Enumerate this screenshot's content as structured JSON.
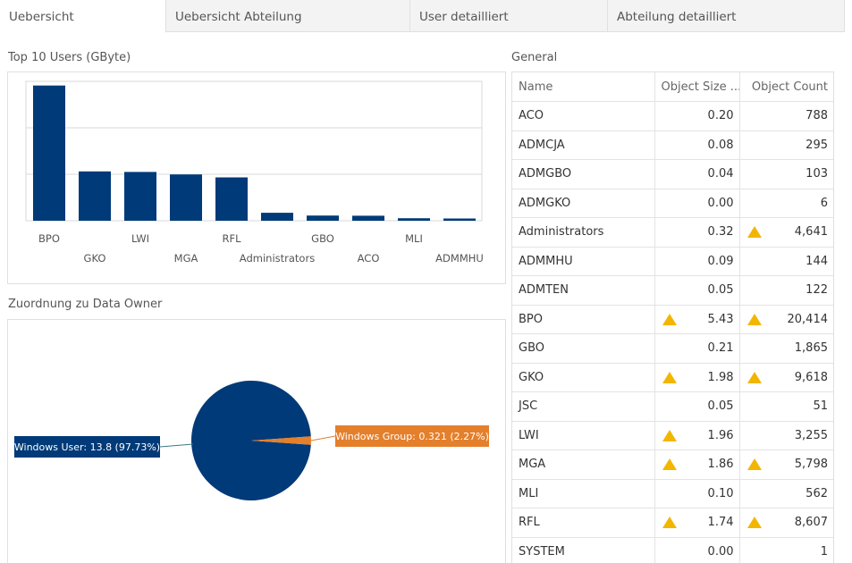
{
  "tabs": [
    "Uebersicht",
    "Uebersicht Abteilung",
    "User detailliert",
    "Abteilung detailliert"
  ],
  "top_users": {
    "title": "Top 10 Users (GByte)"
  },
  "owner": {
    "title": "Zuordnung zu Data Owner"
  },
  "general": {
    "title": "General",
    "columns": [
      "Name",
      "Object Size ...",
      "Object Count"
    ],
    "rows": [
      {
        "name": "ACO",
        "size": "0.20",
        "count": "788",
        "size_warn": false,
        "count_warn": false
      },
      {
        "name": "ADMCJA",
        "size": "0.08",
        "count": "295",
        "size_warn": false,
        "count_warn": false
      },
      {
        "name": "ADMGBO",
        "size": "0.04",
        "count": "103",
        "size_warn": false,
        "count_warn": false
      },
      {
        "name": "ADMGKO",
        "size": "0.00",
        "count": "6",
        "size_warn": false,
        "count_warn": false
      },
      {
        "name": "Administrators",
        "size": "0.32",
        "count": "4,641",
        "size_warn": false,
        "count_warn": true
      },
      {
        "name": "ADMMHU",
        "size": "0.09",
        "count": "144",
        "size_warn": false,
        "count_warn": false
      },
      {
        "name": "ADMTEN",
        "size": "0.05",
        "count": "122",
        "size_warn": false,
        "count_warn": false
      },
      {
        "name": "BPO",
        "size": "5.43",
        "count": "20,414",
        "size_warn": true,
        "count_warn": true
      },
      {
        "name": "GBO",
        "size": "0.21",
        "count": "1,865",
        "size_warn": false,
        "count_warn": false
      },
      {
        "name": "GKO",
        "size": "1.98",
        "count": "9,618",
        "size_warn": true,
        "count_warn": true
      },
      {
        "name": "JSC",
        "size": "0.05",
        "count": "51",
        "size_warn": false,
        "count_warn": false
      },
      {
        "name": "LWI",
        "size": "1.96",
        "count": "3,255",
        "size_warn": true,
        "count_warn": false
      },
      {
        "name": "MGA",
        "size": "1.86",
        "count": "5,798",
        "size_warn": true,
        "count_warn": true
      },
      {
        "name": "MLI",
        "size": "0.10",
        "count": "562",
        "size_warn": false,
        "count_warn": false
      },
      {
        "name": "RFL",
        "size": "1.74",
        "count": "8,607",
        "size_warn": true,
        "count_warn": true
      },
      {
        "name": "SYSTEM",
        "size": "0.00",
        "count": "1",
        "size_warn": false,
        "count_warn": false
      }
    ]
  },
  "colors": {
    "bar": "#003a78",
    "pie_main": "#003a78",
    "pie_secondary": "#e47f2c",
    "warning": "#f2b600"
  },
  "chart_data": [
    {
      "type": "bar",
      "categories": [
        "BPO",
        "GKO",
        "LWI",
        "MGA",
        "RFL",
        "Administrators",
        "GBO",
        "ACO",
        "MLI",
        "ADMMHU"
      ],
      "values": [
        5.43,
        1.98,
        1.96,
        1.86,
        1.74,
        0.32,
        0.21,
        0.2,
        0.1,
        0.09
      ],
      "title": "Top 10 Users (GByte)",
      "ylim": [
        0,
        5.6
      ],
      "grid": true
    },
    {
      "type": "pie",
      "labels": [
        "Windows User: 13.8 (97.73%)",
        "Windows Group: 0.321 (2.27%)"
      ],
      "values": [
        13.8,
        0.321
      ],
      "title": "Zuordnung zu Data Owner"
    }
  ]
}
